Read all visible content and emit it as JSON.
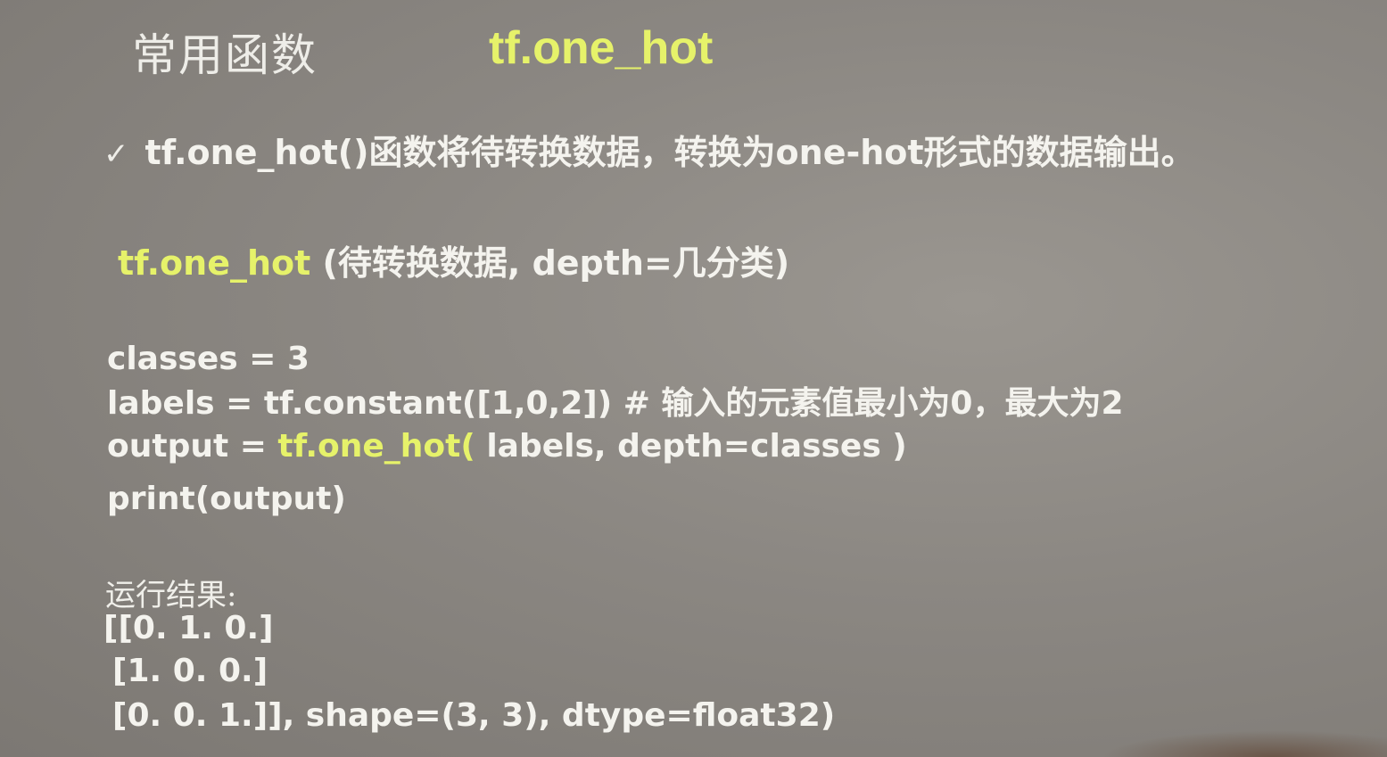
{
  "slide": {
    "heading": "常用函数",
    "title": "tf.one_hot",
    "bullet": {
      "check": "✓",
      "text": "tf.one_hot()函数将待转换数据，转换为one-hot形式的数据输出。"
    },
    "signature": {
      "fn": "tf.one_hot",
      "args": " (待转换数据, depth=几分类)"
    },
    "code": {
      "line1": "classes = 3",
      "line2": "labels = tf.constant([1,0,2])  # 输入的元素值最小为0，最大为2",
      "line3_prefix": "output = ",
      "line3_fn": "tf.one_hot(",
      "line3_suffix": " labels, depth=classes )",
      "line4": "print(output)"
    },
    "result": {
      "label": "运行结果:",
      "line1": "[[0. 1. 0.]",
      "line2": " [1. 0. 0.]",
      "line3": "[0. 0. 1.]], shape=(3, 3), dtype=float32)"
    }
  }
}
